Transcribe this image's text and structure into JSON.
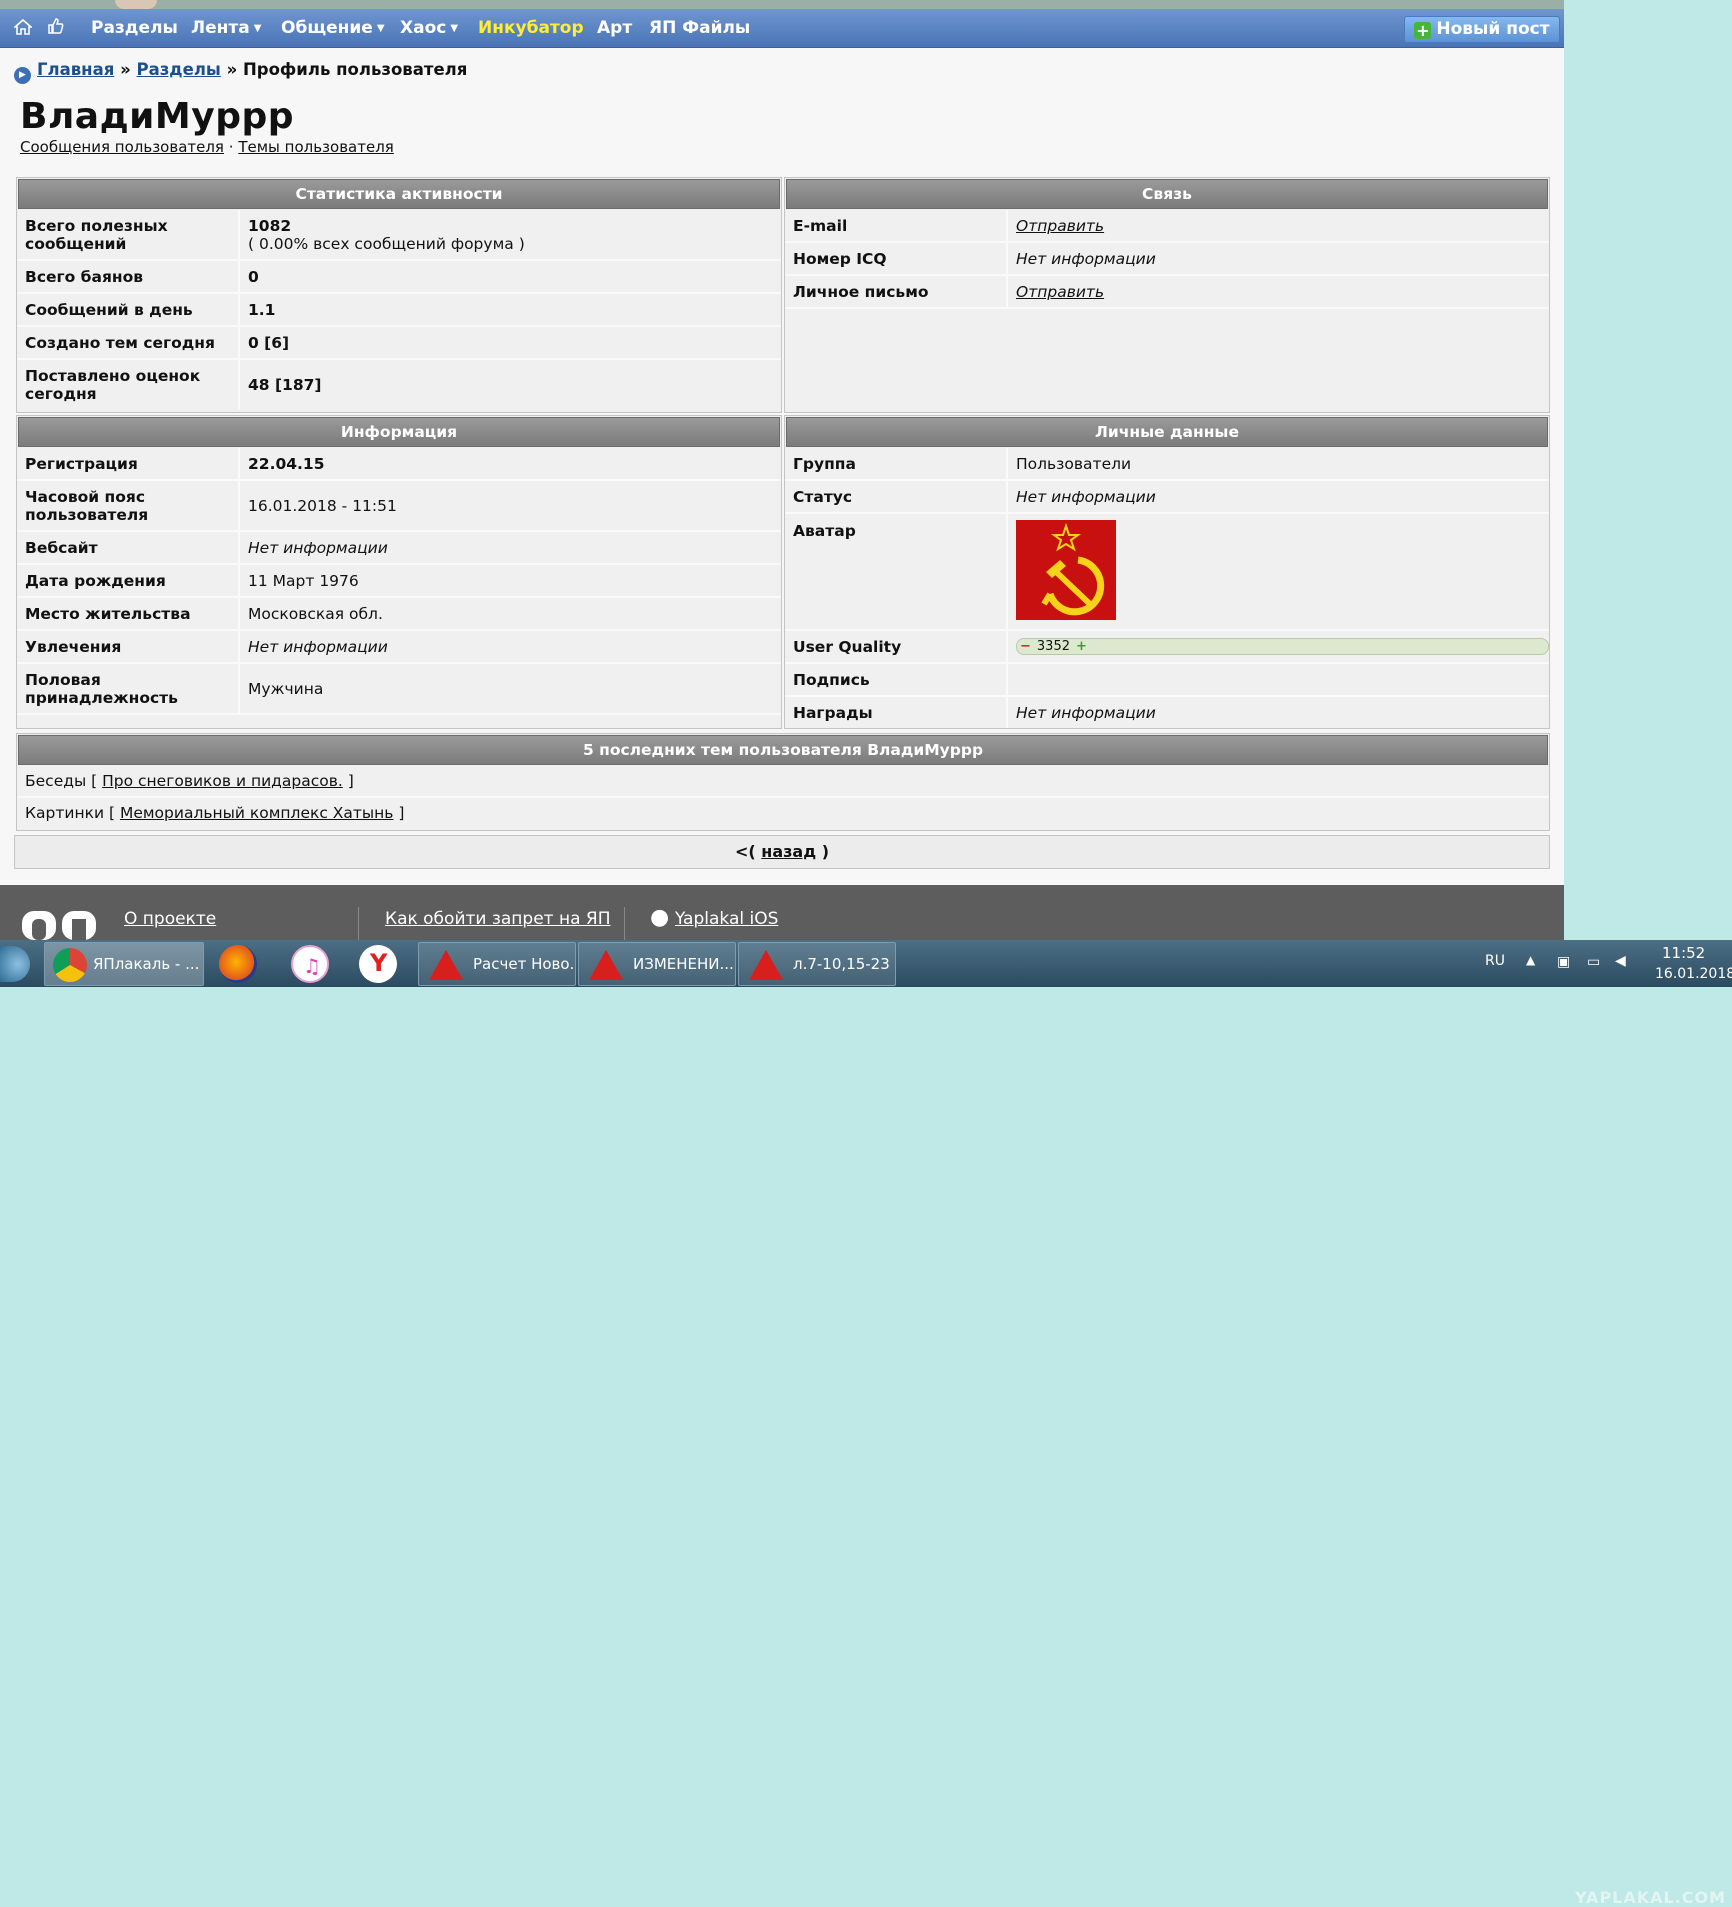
{
  "nav": {
    "home_icon": "home-icon",
    "like_icon": "thumbs-up-icon",
    "items": [
      "Разделы",
      "Лента",
      "Общение",
      "Хаос",
      "Инкубатор",
      "Арт",
      "ЯП Файлы"
    ],
    "new_post": "Новый пост"
  },
  "breadcrumb": {
    "home": "Главная",
    "sections": "Разделы",
    "current": "» Профиль пользователя",
    "sep": "»"
  },
  "profile": {
    "username": "ВладиМуррр",
    "link_messages": "Сообщения пользователя",
    "link_sep": "·",
    "link_topics": "Темы пользователя"
  },
  "stats": {
    "title": "Статистика активности",
    "rows": [
      {
        "label": "Всего полезных сообщений",
        "value": "1082",
        "sub": "( 0.00% всех сообщений форума )"
      },
      {
        "label": "Всего баянов",
        "value": "0"
      },
      {
        "label": "Сообщений в день",
        "value": "1.1"
      },
      {
        "label": "Создано тем сегодня",
        "value": "0 [6]"
      },
      {
        "label": "Поставлено оценок сегодня",
        "value": "48 [187]"
      }
    ]
  },
  "contact": {
    "title": "Связь",
    "rows": [
      {
        "label": "E-mail",
        "value": "Отправить"
      },
      {
        "label": "Номер ICQ",
        "value": "Нет информации"
      },
      {
        "label": "Личное письмо",
        "value": "Отправить"
      }
    ]
  },
  "info": {
    "title": "Информация",
    "rows": [
      {
        "label": "Регистрация",
        "value": "22.04.15"
      },
      {
        "label": "Часовой пояс пользователя",
        "value": "16.01.2018 - 11:51"
      },
      {
        "label": "Вебсайт",
        "value": "Нет информации"
      },
      {
        "label": "Дата рождения",
        "value": "11 Март 1976"
      },
      {
        "label": "Место жительства",
        "value": "Московская обл."
      },
      {
        "label": "Увлечения",
        "value": "Нет информации"
      },
      {
        "label": "Половая принадлежность",
        "value": "Мужчина"
      }
    ]
  },
  "personal": {
    "title": "Личные данные",
    "rows": [
      {
        "label": "Группа",
        "value": "Пользователи"
      },
      {
        "label": "Статус",
        "value": "Нет информации"
      },
      {
        "label": "Аватар",
        "value": "hammer-and-sickle-avatar"
      },
      {
        "label": "User Quality",
        "value": "3352",
        "minus": "−",
        "plus": "+"
      },
      {
        "label": "Подпись",
        "value": ""
      },
      {
        "label": "Награды",
        "value": "Нет информации"
      }
    ]
  },
  "topics": {
    "title": "5 последних тем пользователя ВладиМуррр",
    "items": [
      {
        "section": "Беседы",
        "open": "[",
        "title": "Про снеговиков и пидарасов.",
        "close": "]"
      },
      {
        "section": "Картинки",
        "open": "[",
        "title": "Мемориальный комплекс Хатынь",
        "close": "]"
      }
    ]
  },
  "back": {
    "prefix": "<(",
    "link": "назад",
    "suffix": ")"
  },
  "footer": {
    "about": "О проекте",
    "bypass": "Как обойти запрет на ЯП",
    "ios": "Yaplakal iOS",
    "apple_icon": "apple-icon"
  },
  "taskbar": {
    "start_icon": "windows-start-icon",
    "buttons": [
      "ЯПлакаль - ...",
      "Расчет Ново...",
      "ИЗМЕНЕНИ...",
      "л.7-10,15-23 ..."
    ],
    "apps": [
      "chrome-icon",
      "firefox-icon",
      "itunes-icon",
      "yandex-browser-icon"
    ],
    "lang": "RU",
    "time": "11:52",
    "date": "16.01.2018",
    "watermark": "YAPLAKAL.COM"
  },
  "colors": {
    "navbar": "#4a74b7",
    "header_gray": "#8a8a8a",
    "avatar_red": "#c81010",
    "incubator": "#ffee33"
  }
}
